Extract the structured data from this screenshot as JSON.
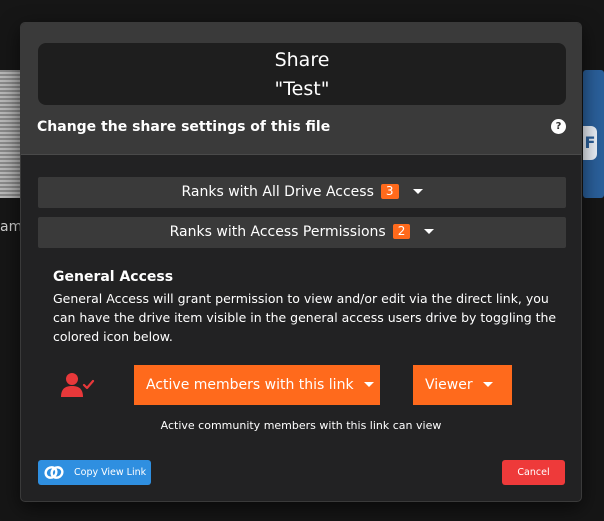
{
  "background": {
    "left_text": "am",
    "right_card_text": "F"
  },
  "modal": {
    "title_line1": "Share",
    "title_line2": "\"Test\"",
    "subtitle": "Change the share settings of this file",
    "help_icon": "?",
    "accordions": [
      {
        "label": "Ranks with All Drive Access",
        "count": "3"
      },
      {
        "label": "Ranks with Access Permissions",
        "count": "2"
      }
    ],
    "general_access": {
      "title": "General Access",
      "description": "General Access will grant permission to view and/or edit via the direct link, you can have the drive item visible in the general access users drive by toggling the colored icon below.",
      "link_mode": "Active members with this link",
      "role": "Viewer",
      "hint": "Active community members with this link can view"
    },
    "footer": {
      "copy_label": "Copy View Link",
      "cancel_label": "Cancel"
    }
  },
  "colors": {
    "accent": "#ff6a1c",
    "copy_button": "#2f8fe0",
    "cancel_button": "#ee3a3a",
    "user_icon": "#e8383a"
  },
  "icons": [
    "help-icon",
    "chevron-down-icon",
    "user-check-icon",
    "link-icon"
  ]
}
